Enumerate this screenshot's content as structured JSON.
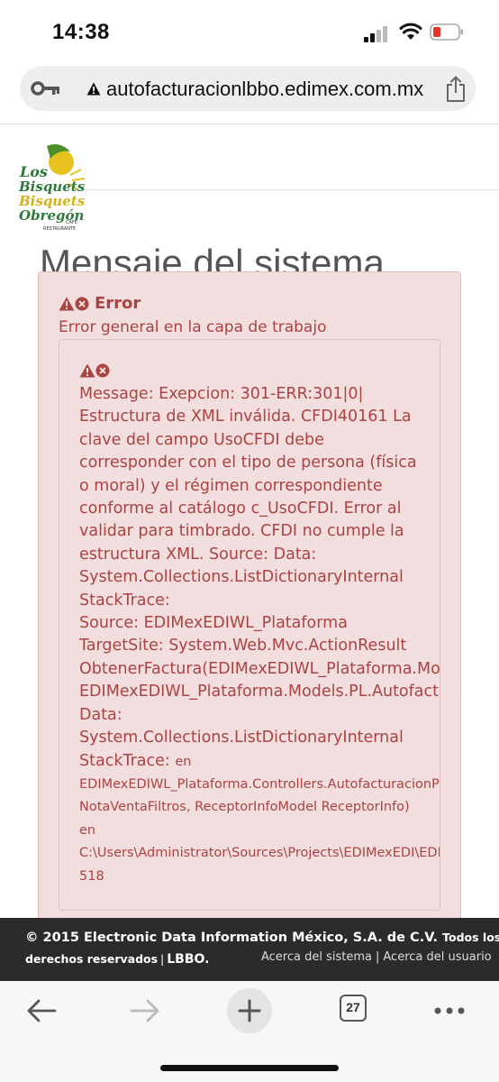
{
  "status_bar": {
    "time": "14:38"
  },
  "browser": {
    "url": "autofacturacionlbbo.edimex.com.mx",
    "tab_count": "27"
  },
  "logo": {
    "line1": "Los",
    "line2": "Bisquets",
    "line3": "Bisquets",
    "line4": "Obregón",
    "line5": "CAFÉ",
    "line6": "RESTAURANTE"
  },
  "page": {
    "title": "Mensaje del sistema"
  },
  "alert": {
    "title": "Error",
    "subtitle": "Error general en la capa de trabajo",
    "lines": [
      "Message: Exepcion: 301-ERR:301|0|",
      "Estructura de XML inválida. CFDI40161 La",
      "clave del campo UsoCFDI debe",
      "corresponder con el tipo de persona (física",
      "o moral) y el régimen correspondiente",
      "conforme al catálogo c_UsoCFDI. Error al",
      "validar para timbrado. CFDI no cumple la",
      "estructura XML. Source: Data:",
      "System.Collections.ListDictionaryInternal",
      "StackTrace:",
      "Source: EDIMexEDIWL_Plataforma",
      "TargetSite: System.Web.Mvc.ActionResult",
      "ObtenerFactura(EDIMexEDIWL_Plataforma.Models.PL.A",
      "EDIMexEDIWL_Plataforma.Models.PL.Autofacturacion.",
      "Data:",
      "System.Collections.ListDictionaryInternal"
    ],
    "stacktrace_label": "StackTrace:",
    "stacktrace_en": "en",
    "small_lines": [
      "EDIMexEDIWL_Plataforma.Controllers.AutofacturacionPublicoCo",
      "NotaVentaFiltros, ReceptorInfoModel ReceptorInfo)",
      "en",
      "C:\\Users\\Administrator\\Sources\\Projects\\EDIMexEDI\\EDIMexEDI",
      "518"
    ]
  },
  "footer": {
    "copyright": "© 2015 Electronic Data Information México, S.A. de C.V.",
    "rights_a": "Todos los",
    "rights_b": "derechos reservados",
    "separator": "|",
    "brand": "LBBO.",
    "link_system": "Acerca del sistema",
    "link_user": "Acerca del usuario"
  },
  "colors": {
    "error_text": "#a94442",
    "error_bg": "#f2dede",
    "footer_bg": "#2b2b2b"
  }
}
